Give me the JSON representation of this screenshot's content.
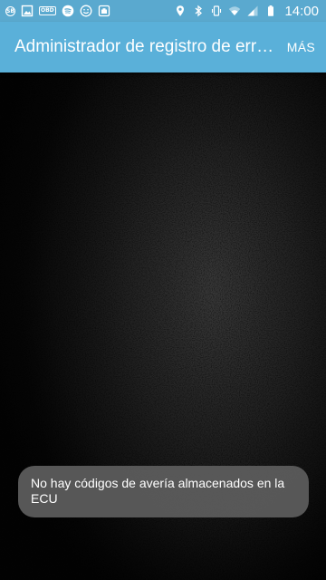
{
  "status_bar": {
    "left_icons": [
      "sync-badge-icon",
      "gallery-icon",
      "obd-icon",
      "spotify-icon",
      "smiley-icon",
      "camera-app-icon"
    ],
    "sync_badge_text": "SB",
    "obd_label": "OBD",
    "right_icons": [
      "location-icon",
      "bluetooth-icon",
      "vibrate-icon",
      "wifi-icon",
      "signal-icon",
      "battery-icon"
    ],
    "time": "14:00"
  },
  "app_bar": {
    "title": "Administrador de registro de errores",
    "more_label": "MÁS",
    "color": "#5ab0d9"
  },
  "toast": {
    "message": "No hay códigos de avería almacenados en la ECU"
  },
  "colors": {
    "status_bar": "#5aa9cf",
    "app_bar": "#5ab0d9",
    "toast_bg": "#5c5c5c"
  }
}
